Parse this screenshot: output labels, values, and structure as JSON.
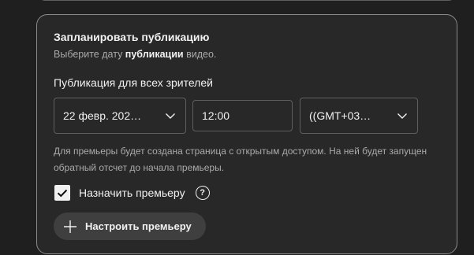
{
  "schedule": {
    "title": "Запланировать публикацию",
    "subtitle_pre": "Выберите дату ",
    "subtitle_bold": "публикации",
    "subtitle_post": " видео.",
    "section_label": "Публикация для всех зрителей",
    "date_value": "22 февр. 202…",
    "time_value": "12:00",
    "timezone_value": "((GMT+03…",
    "hint_text": "Для премьеры будет создана страница с открытым доступом. На ней будет запущен обратный отсчет до начала премьеры.",
    "premiere_checkbox_label": "Назначить премьеру",
    "premiere_checked": true,
    "help_glyph": "?",
    "setup_premiere_label": "Настроить премьеру"
  },
  "icons": {
    "date_dropdown": "chevron-down-icon",
    "timezone_dropdown": "chevron-down-icon",
    "checkbox": "check-icon",
    "help": "help-circle-icon",
    "setup": "plus-icon"
  }
}
